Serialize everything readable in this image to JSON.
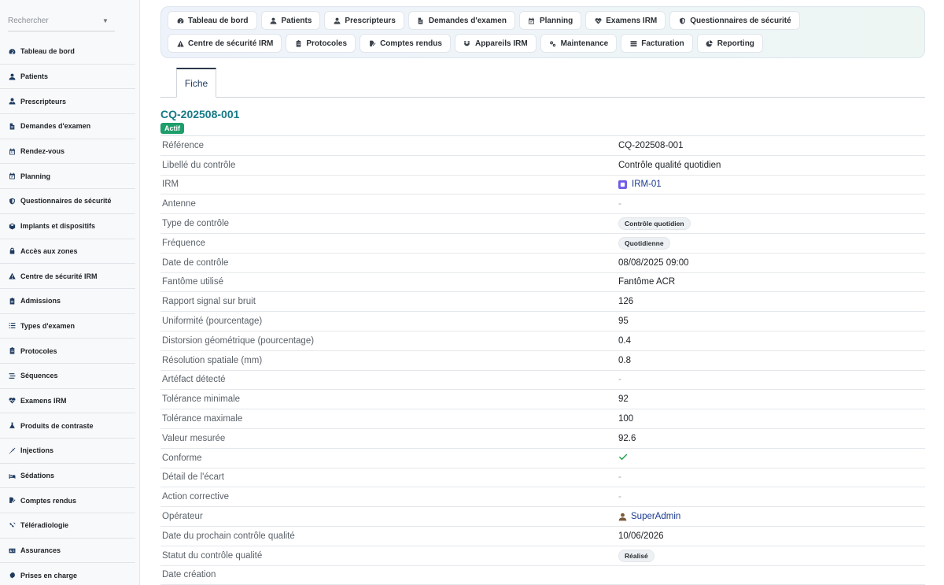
{
  "sidebar": {
    "search_placeholder": "Rechercher",
    "items": [
      {
        "label": "Tableau de bord",
        "icon": "dashboard-icon"
      },
      {
        "label": "Patients",
        "icon": "user-icon"
      },
      {
        "label": "Prescripteurs",
        "icon": "doctor-icon"
      },
      {
        "label": "Demandes d'examen",
        "icon": "file-icon"
      },
      {
        "label": "Rendez-vous",
        "icon": "calendar-icon"
      },
      {
        "label": "Planning",
        "icon": "calendar-check-icon"
      },
      {
        "label": "Questionnaires de sécurité",
        "icon": "shield-icon"
      },
      {
        "label": "Implants et dispositifs",
        "icon": "cube-icon"
      },
      {
        "label": "Accès aux zones",
        "icon": "lock-icon"
      },
      {
        "label": "Centre de sécurité IRM",
        "icon": "warning-icon"
      },
      {
        "label": "Admissions",
        "icon": "clipboard-icon"
      },
      {
        "label": "Types d'examen",
        "icon": "list-icon"
      },
      {
        "label": "Protocoles",
        "icon": "clipboard-list-icon"
      },
      {
        "label": "Séquences",
        "icon": "stream-icon"
      },
      {
        "label": "Examens IRM",
        "icon": "heartbeat-icon"
      },
      {
        "label": "Produits de contraste",
        "icon": "flask-icon"
      },
      {
        "label": "Injections",
        "icon": "syringe-icon"
      },
      {
        "label": "Sédations",
        "icon": "bed-icon"
      },
      {
        "label": "Comptes rendus",
        "icon": "file-signature-icon"
      },
      {
        "label": "Téléradiologie",
        "icon": "satellite-icon"
      },
      {
        "label": "Assurances",
        "icon": "id-card-icon"
      },
      {
        "label": "Prises en charge",
        "icon": "certificate-icon"
      }
    ]
  },
  "topnav": [
    {
      "label": "Tableau de bord",
      "icon": "dashboard-icon"
    },
    {
      "label": "Patients",
      "icon": "user-icon"
    },
    {
      "label": "Prescripteurs",
      "icon": "doctor-icon"
    },
    {
      "label": "Demandes d'examen",
      "icon": "file-icon"
    },
    {
      "label": "Planning",
      "icon": "calendar-check-icon"
    },
    {
      "label": "Examens IRM",
      "icon": "heartbeat-icon"
    },
    {
      "label": "Questionnaires de sécurité",
      "icon": "shield-icon"
    },
    {
      "label": "Centre de sécurité IRM",
      "icon": "warning-icon"
    },
    {
      "label": "Protocoles",
      "icon": "clipboard-list-icon"
    },
    {
      "label": "Comptes rendus",
      "icon": "file-signature-icon"
    },
    {
      "label": "Appareils IRM",
      "icon": "magnet-icon"
    },
    {
      "label": "Maintenance",
      "icon": "cogs-icon"
    },
    {
      "label": "Facturation",
      "icon": "money-icon"
    },
    {
      "label": "Reporting",
      "icon": "pie-chart-icon"
    }
  ],
  "tabs": {
    "active": "Fiche"
  },
  "record": {
    "title": "CQ-202508-001",
    "status_badge": "Actif",
    "fields": [
      {
        "label": "Référence",
        "value": "CQ-202508-001",
        "kind": "text"
      },
      {
        "label": "Libellé du contrôle",
        "value": "Contrôle qualité quotidien",
        "kind": "text"
      },
      {
        "label": "IRM",
        "value": "IRM-01",
        "kind": "irm-link"
      },
      {
        "label": "Antenne",
        "value": "-",
        "kind": "dash"
      },
      {
        "label": "Type de contrôle",
        "value": "Contrôle quotidien",
        "kind": "pill"
      },
      {
        "label": "Fréquence",
        "value": "Quotidienne",
        "kind": "pill"
      },
      {
        "label": "Date de contrôle",
        "value": "08/08/2025 09:00",
        "kind": "text"
      },
      {
        "label": "Fantôme utilisé",
        "value": "Fantôme ACR",
        "kind": "text"
      },
      {
        "label": "Rapport signal sur bruit",
        "value": "126",
        "kind": "text"
      },
      {
        "label": "Uniformité (pourcentage)",
        "value": "95",
        "kind": "text"
      },
      {
        "label": "Distorsion géométrique (pourcentage)",
        "value": "0.4",
        "kind": "text"
      },
      {
        "label": "Résolution spatiale (mm)",
        "value": "0.8",
        "kind": "text"
      },
      {
        "label": "Artéfact détecté",
        "value": "-",
        "kind": "dash"
      },
      {
        "label": "Tolérance minimale",
        "value": "92",
        "kind": "text"
      },
      {
        "label": "Tolérance maximale",
        "value": "100",
        "kind": "text"
      },
      {
        "label": "Valeur mesurée",
        "value": "92.6",
        "kind": "text"
      },
      {
        "label": "Conforme",
        "value": "",
        "kind": "check"
      },
      {
        "label": "Détail de l'écart",
        "value": "-",
        "kind": "dash"
      },
      {
        "label": "Action corrective",
        "value": "-",
        "kind": "dash"
      },
      {
        "label": "Opérateur",
        "value": "SuperAdmin",
        "kind": "user-link"
      },
      {
        "label": "Date du prochain contrôle qualité",
        "value": "10/06/2026",
        "kind": "text"
      },
      {
        "label": "Statut du contrôle qualité",
        "value": "Réalisé",
        "kind": "pill"
      },
      {
        "label": "Date création",
        "value": "",
        "kind": "text"
      }
    ]
  },
  "colors": {
    "accent": "#167a87",
    "success": "#1e9e6a",
    "link": "#1a3a8f",
    "irm_icon": "#6f5ce8"
  }
}
